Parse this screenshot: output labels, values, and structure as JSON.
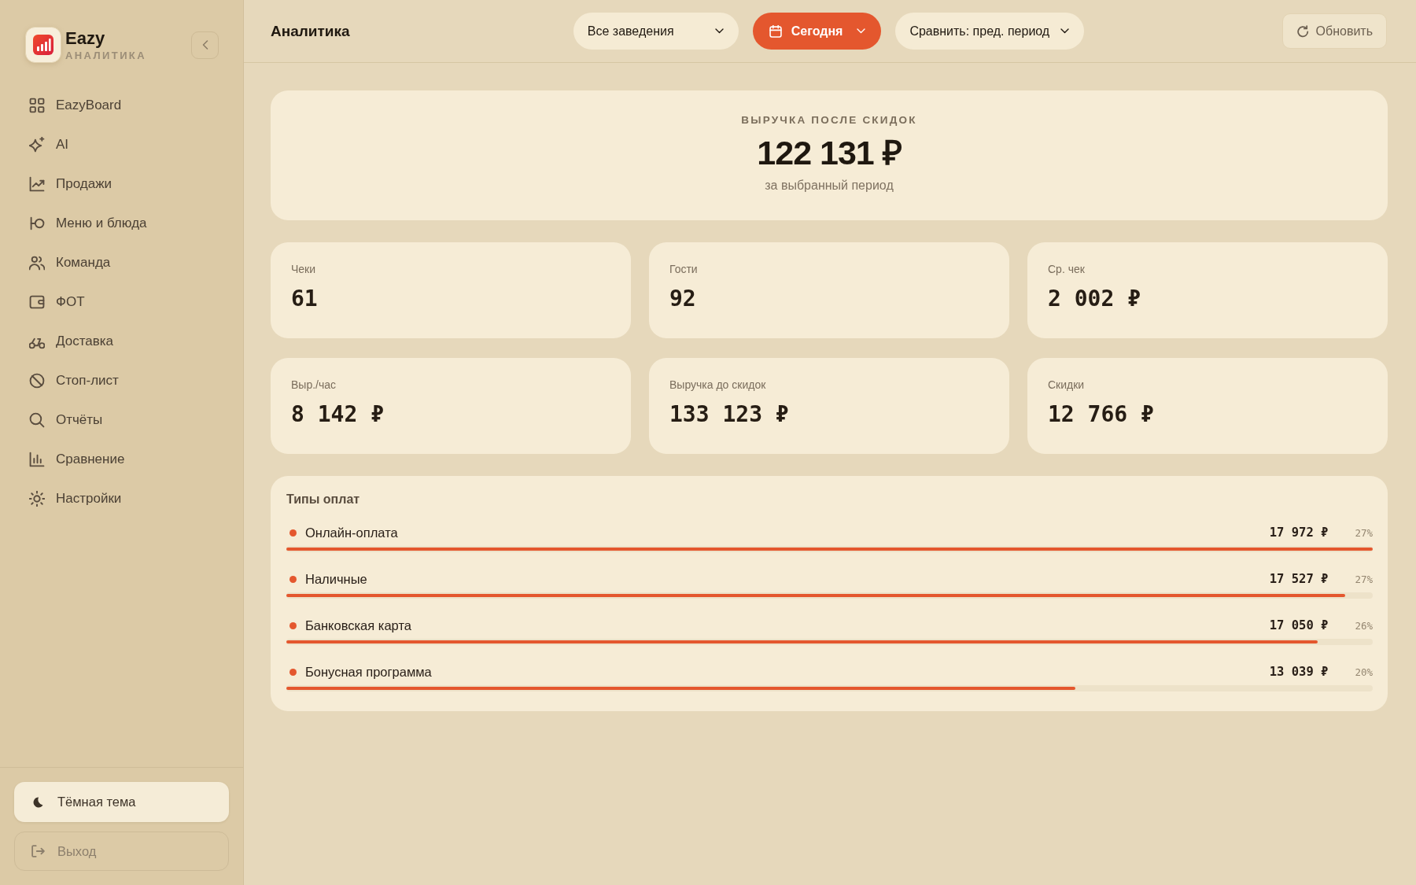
{
  "sidebar": {
    "brand": {
      "name": "Eazy",
      "subtitle": "АНАЛИТИКА"
    },
    "items": [
      {
        "label": "EazyBoard",
        "selected": false
      },
      {
        "label": "AI",
        "selected": false
      },
      {
        "label": "Продажи",
        "selected": false
      },
      {
        "label": "Меню и блюда",
        "selected": false
      },
      {
        "label": "Команда",
        "selected": false
      },
      {
        "label": "ФОТ",
        "selected": false
      },
      {
        "label": "Доставка",
        "selected": false
      },
      {
        "label": "Стоп-лист",
        "selected": false
      },
      {
        "label": "Отчёты",
        "selected": false
      },
      {
        "label": "Сравнение",
        "selected": false
      },
      {
        "label": "Настройки",
        "selected": false
      }
    ],
    "theme_button": "Тёмная тема",
    "logout_button": "Выход"
  },
  "header": {
    "title": "Аналитика",
    "filters": [
      {
        "kind": "dropdown",
        "label": "Все заведения"
      },
      {
        "kind": "date",
        "label": "Сегодня"
      },
      {
        "kind": "dropdown",
        "label": "Сравнить: пред. период"
      }
    ],
    "refresh_button": "Обновить"
  },
  "revenue": {
    "label": "ВЫРУЧКА ПОСЛЕ СКИДОК",
    "value": "122 131 ₽",
    "caption": "за выбранный период"
  },
  "metrics": [
    {
      "label": "Чеки",
      "value": "61"
    },
    {
      "label": "Гости",
      "value": "92"
    },
    {
      "label": "Ср. чек",
      "value": "2 002 ₽"
    },
    {
      "label": "Выр./час",
      "value": "8 142 ₽"
    },
    {
      "label": "Выручка до скидок",
      "value": "133 123 ₽"
    },
    {
      "label": "Скидки",
      "value": "12 766 ₽"
    }
  ],
  "payment_types": {
    "title": "Типы оплат",
    "rows": [
      {
        "name": "Онлайн-оплата",
        "amount": "17 972 ₽",
        "share": "27%",
        "level": 1
      },
      {
        "name": "Наличные",
        "amount": "17 527 ₽",
        "share": "27%",
        "level": 0.975
      },
      {
        "name": "Банковская карта",
        "amount": "17 050 ₽",
        "share": "26%",
        "level": 0.949
      },
      {
        "name": "Бонусная программа",
        "amount": "13 039 ₽",
        "share": "20%",
        "level": 0.726
      }
    ]
  }
}
